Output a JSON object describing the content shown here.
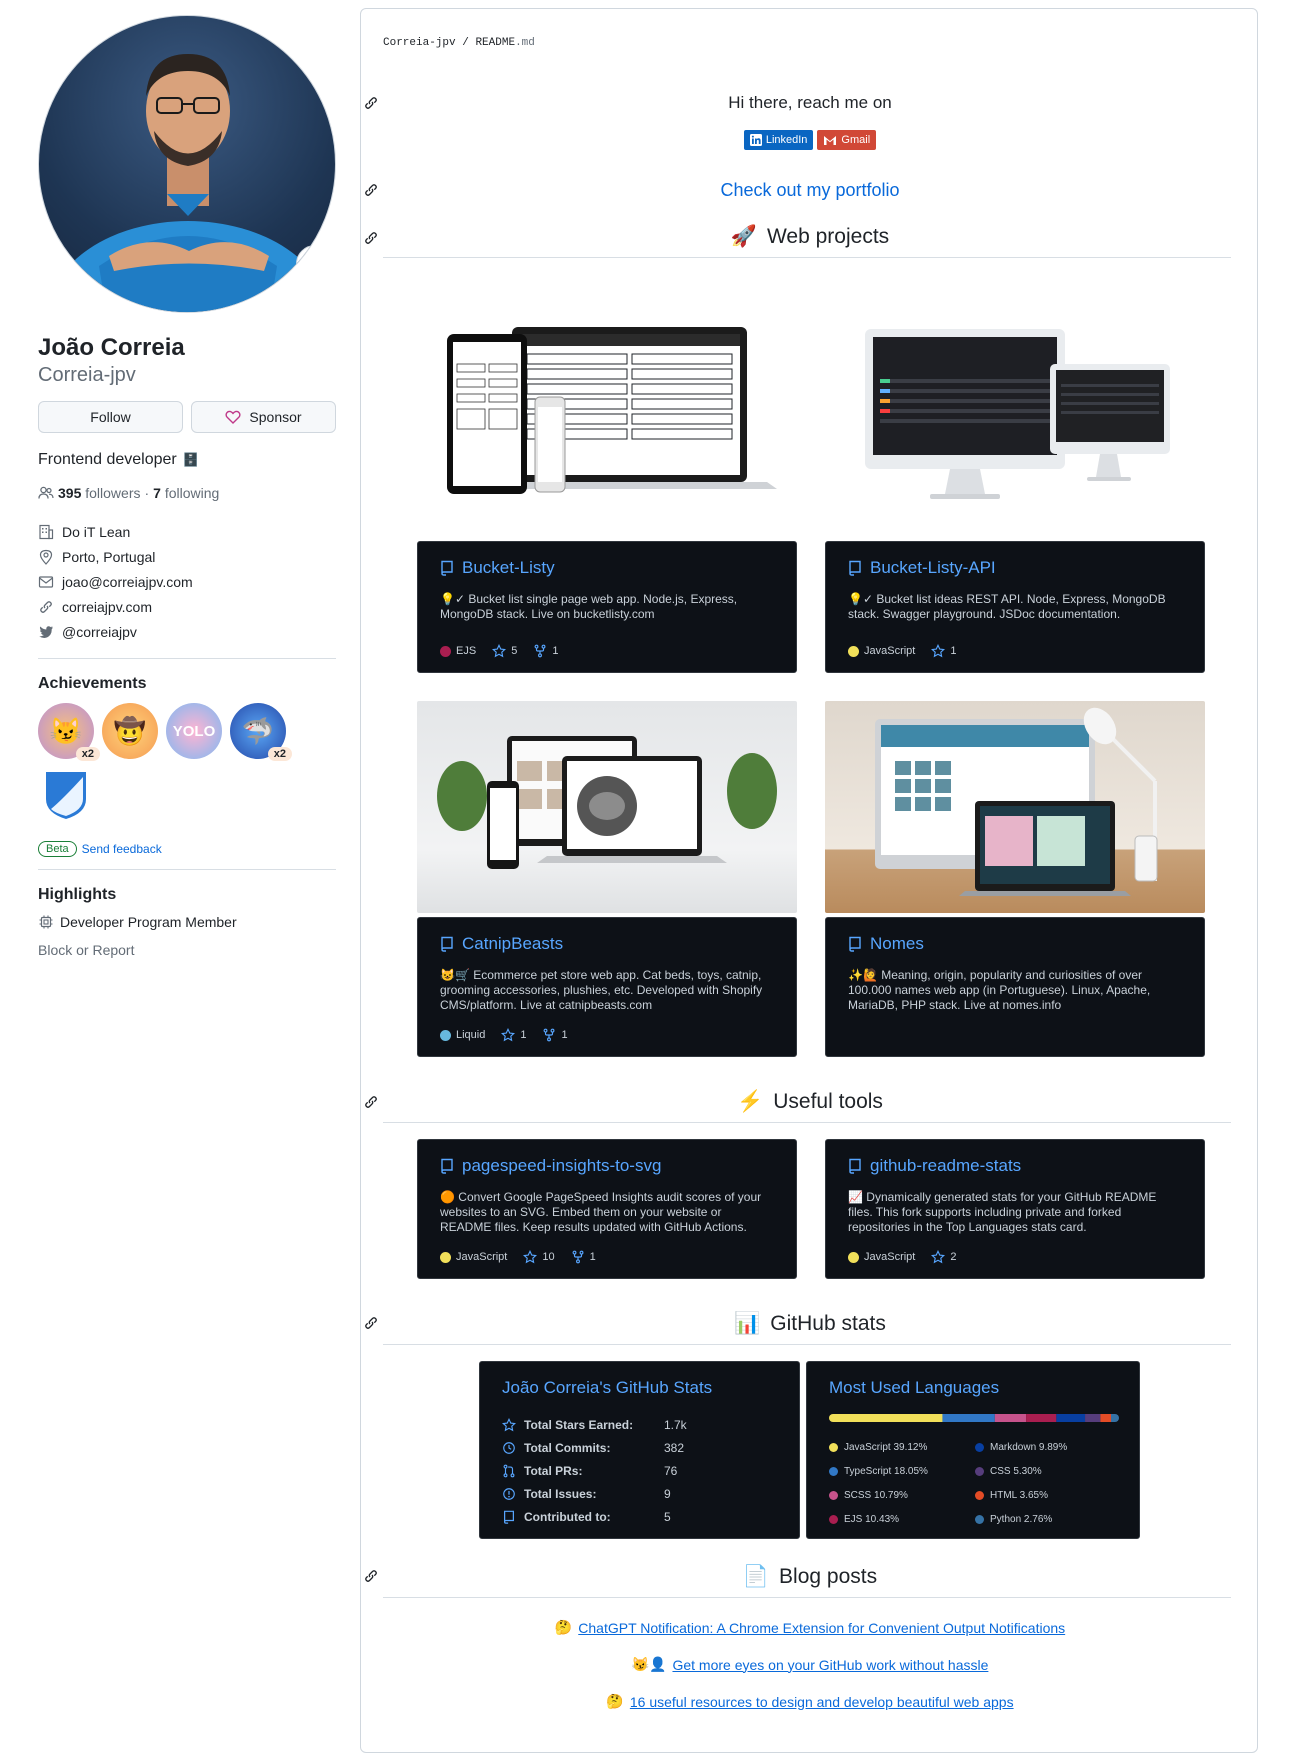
{
  "profile": {
    "name": "João Correia",
    "login": "Correia-jpv",
    "follow_label": "Follow",
    "sponsor_label": "Sponsor",
    "bio": "Frontend developer",
    "followers_count": "395",
    "followers_label": "followers",
    "dot": "·",
    "following_count": "7",
    "following_label": "following",
    "company": "Do iT Lean",
    "location": "Porto, Portugal",
    "email": "joao@correiajpv.com",
    "website": "correiajpv.com",
    "twitter": "@correiajpv",
    "achievements_title": "Achievements",
    "achievements": [
      {
        "icon": "quickdraw-badge-icon",
        "count": "x2"
      },
      {
        "icon": "pull-shark-cowboy-badge-icon",
        "count": ""
      },
      {
        "icon": "yolo-badge-icon",
        "count": ""
      },
      {
        "icon": "shark-badge-icon",
        "count": "x2"
      },
      {
        "icon": "arctic-code-vault-badge-icon",
        "count": ""
      }
    ],
    "beta_label": "Beta",
    "feedback_label": "Send feedback",
    "highlights_title": "Highlights",
    "highlight_item": "Developer Program Member",
    "block_label": "Block or Report"
  },
  "readme": {
    "breadcrumb_user": "Correia-jpv",
    "breadcrumb_sep": "/",
    "breadcrumb_file": "README",
    "breadcrumb_ext": ".md",
    "greeting": "Hi there, reach me on",
    "badge_linkedin": "LinkedIn",
    "badge_gmail": "Gmail",
    "portfolio_link": "Check out my portfolio",
    "web_projects_title": "Web projects",
    "useful_tools_title": "Useful tools",
    "github_stats_title": "GitHub stats",
    "blog_posts_title": "Blog posts"
  },
  "colors": {
    "link": "#0969da",
    "card_bg": "#0d1117",
    "card_title": "#58a6ff",
    "linkedin": "#0a66c2",
    "gmail": "#d14836"
  },
  "projects": [
    {
      "name": "Bucket-Listy",
      "desc": "💡✓ Bucket list single page web app. Node.js, Express, MongoDB stack. Live on bucketlisty.com",
      "lang": "EJS",
      "lang_color": "#a91e50",
      "stars": "5",
      "forks": "1"
    },
    {
      "name": "Bucket-Listy-API",
      "desc": "💡✓ Bucket list ideas REST API. Node, Express, MongoDB stack. Swagger playground. JSDoc documentation.",
      "lang": "JavaScript",
      "lang_color": "#f1e05a",
      "stars": "1",
      "forks": ""
    },
    {
      "name": "CatnipBeasts",
      "desc": "😺🛒 Ecommerce pet store web app. Cat beds, toys, catnip, grooming accessories, plushies, etc. Developed with Shopify CMS/platform. Live at catnipbeasts.com",
      "lang": "Liquid",
      "lang_color": "#67b8de",
      "stars": "1",
      "forks": "1"
    },
    {
      "name": "Nomes",
      "desc": "✨🙋 Meaning, origin, popularity and curiosities of over 100.000 names web app (in Portuguese). Linux, Apache, MariaDB, PHP stack. Live at nomes.info",
      "lang": "",
      "lang_color": "",
      "stars": "",
      "forks": ""
    }
  ],
  "tools": [
    {
      "name": "pagespeed-insights-to-svg",
      "desc": "🟠 Convert Google PageSpeed Insights audit scores of your websites to an SVG. Embed them on your website or README files. Keep results updated with GitHub Actions.",
      "lang": "JavaScript",
      "lang_color": "#f1e05a",
      "stars": "10",
      "forks": "1"
    },
    {
      "name": "github-readme-stats",
      "desc": "📈 Dynamically generated stats for your GitHub README files. This fork supports including private and forked repositories in the Top Languages stats card.",
      "lang": "JavaScript",
      "lang_color": "#f1e05a",
      "stars": "2",
      "forks": ""
    }
  ],
  "stats": {
    "title": "João Correia's GitHub Stats",
    "rows": [
      {
        "icon": "star-icon",
        "label": "Total Stars Earned:",
        "value": "1.7k"
      },
      {
        "icon": "history-icon",
        "label": "Total Commits:",
        "value": "382"
      },
      {
        "icon": "pull-request-icon",
        "label": "Total PRs:",
        "value": "76"
      },
      {
        "icon": "issue-icon",
        "label": "Total Issues:",
        "value": "9"
      },
      {
        "icon": "repo-icon",
        "label": "Contributed to:",
        "value": "5"
      }
    ]
  },
  "languages": {
    "title": "Most Used Languages",
    "items": [
      {
        "name": "JavaScript",
        "pct": 39.12,
        "label": "JavaScript 39.12%",
        "color": "#f1e05a"
      },
      {
        "name": "TypeScript",
        "pct": 18.05,
        "label": "TypeScript 18.05%",
        "color": "#3178c6"
      },
      {
        "name": "SCSS",
        "pct": 10.79,
        "label": "SCSS 10.79%",
        "color": "#c6538c"
      },
      {
        "name": "EJS",
        "pct": 10.43,
        "label": "EJS 10.43%",
        "color": "#a91e50"
      },
      {
        "name": "Markdown",
        "pct": 9.89,
        "label": "Markdown 9.89%",
        "color": "#083fa1"
      },
      {
        "name": "CSS",
        "pct": 5.3,
        "label": "CSS 5.30%",
        "color": "#563d7c"
      },
      {
        "name": "HTML",
        "pct": 3.65,
        "label": "HTML 3.65%",
        "color": "#e34c26"
      },
      {
        "name": "Python",
        "pct": 2.76,
        "label": "Python 2.76%",
        "color": "#3572a5"
      }
    ]
  },
  "blog": [
    {
      "emoji": "🤔",
      "title": "ChatGPT Notification: A Chrome Extension for Convenient Output Notifications"
    },
    {
      "emoji": "😼👤",
      "title": "Get more eyes on your GitHub work without hassle"
    },
    {
      "emoji": "🤔",
      "title": "16 useful resources to design and develop beautiful web apps"
    }
  ]
}
